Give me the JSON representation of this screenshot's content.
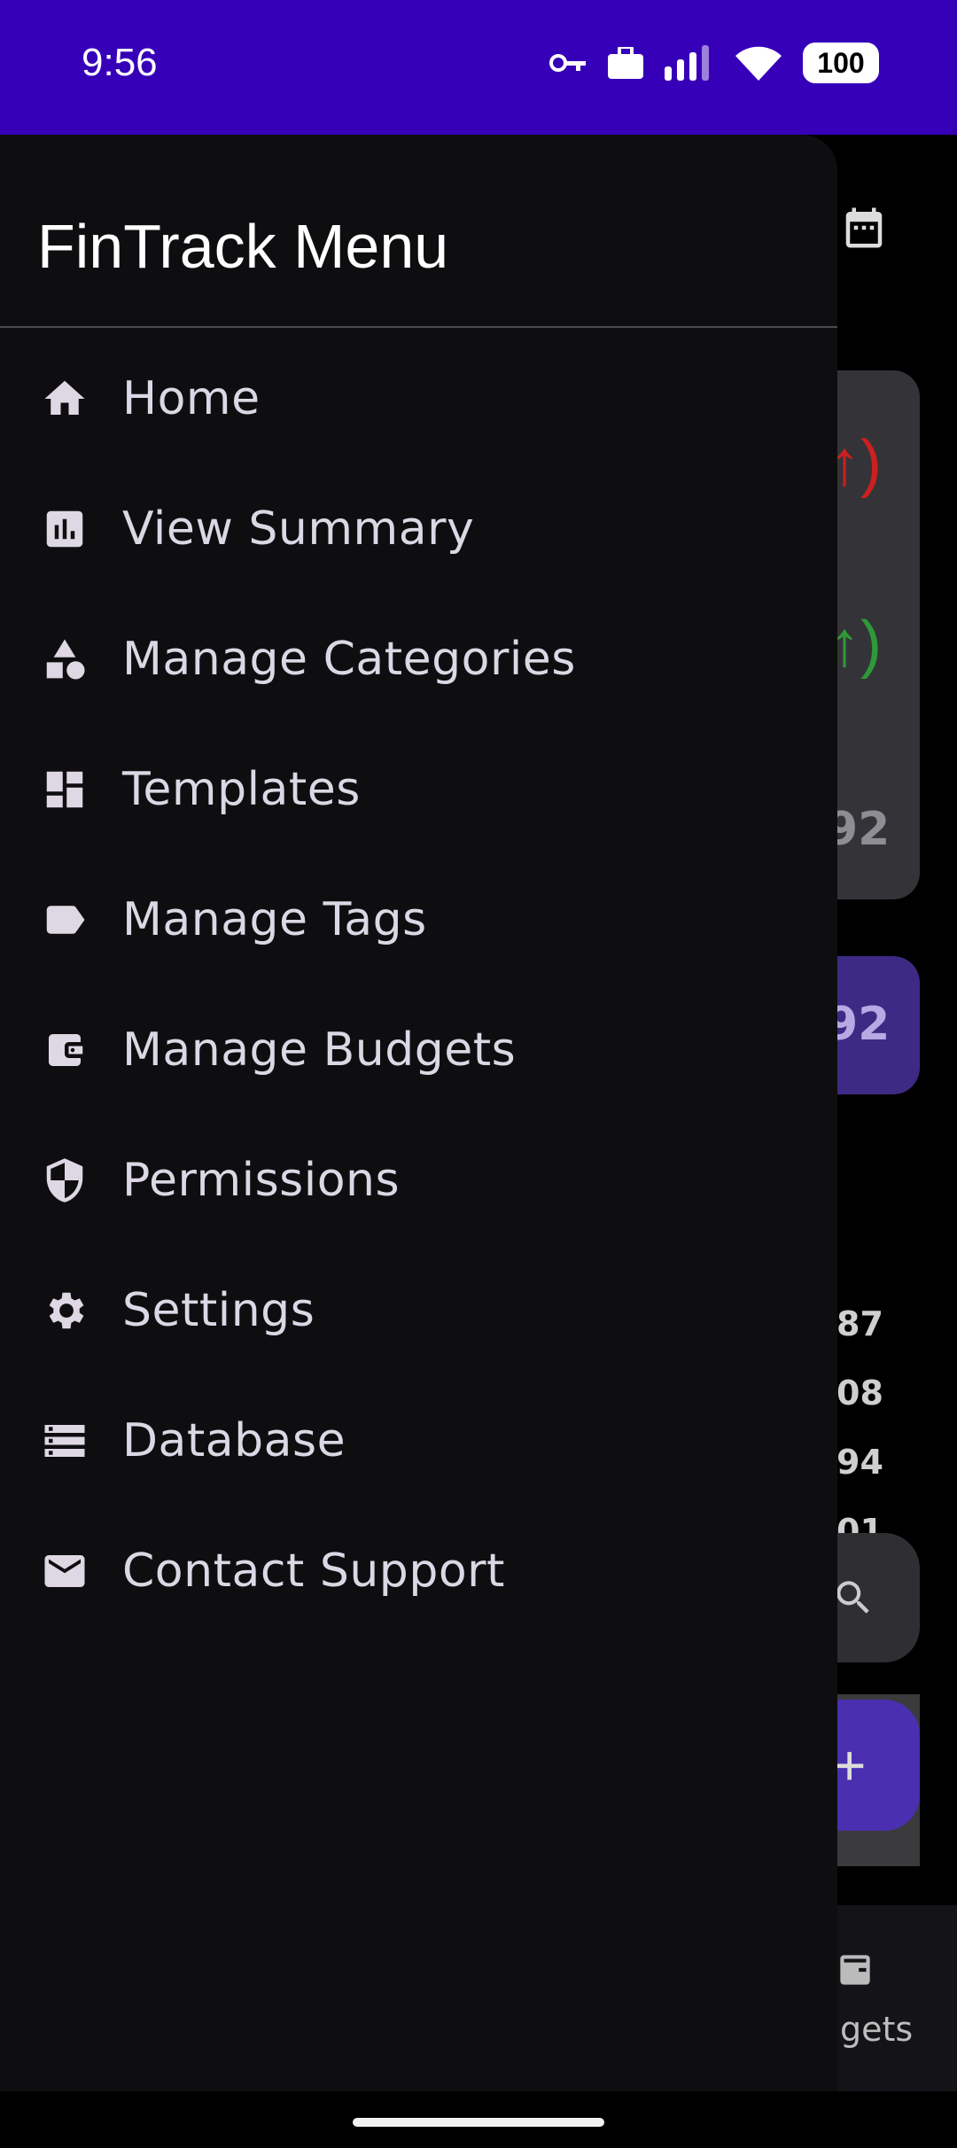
{
  "status": {
    "time": "9:56",
    "battery": "100",
    "icons": [
      "key-icon",
      "briefcase-icon",
      "signal-icon",
      "wifi-icon",
      "battery-icon"
    ]
  },
  "drawer": {
    "title": "FinTrack Menu",
    "items": [
      {
        "label": "Home",
        "icon": "home-icon"
      },
      {
        "label": "View Summary",
        "icon": "bar-chart-icon"
      },
      {
        "label": "Manage Categories",
        "icon": "category-icon"
      },
      {
        "label": "Templates",
        "icon": "dashboard-icon"
      },
      {
        "label": "Manage Tags",
        "icon": "label-icon"
      },
      {
        "label": "Manage Budgets",
        "icon": "wallet-icon"
      },
      {
        "label": "Permissions",
        "icon": "shield-icon"
      },
      {
        "label": "Settings",
        "icon": "gear-icon"
      },
      {
        "label": "Database",
        "icon": "storage-icon"
      },
      {
        "label": "Contact Support",
        "icon": "mail-icon"
      }
    ]
  },
  "background": {
    "arrow_red": "↑)",
    "arrow_green": "↑)",
    "value1": "92",
    "value2": "92",
    "small_values": [
      "87",
      "08",
      "94",
      "01"
    ],
    "fab_label": "+",
    "nav_label": "gets"
  },
  "colors": {
    "status_bar": "#3600b8",
    "drawer_bg": "#0e0e10",
    "accent": "#4a2fb0",
    "expense": "#cc1f1f",
    "income": "#2e9a37"
  }
}
